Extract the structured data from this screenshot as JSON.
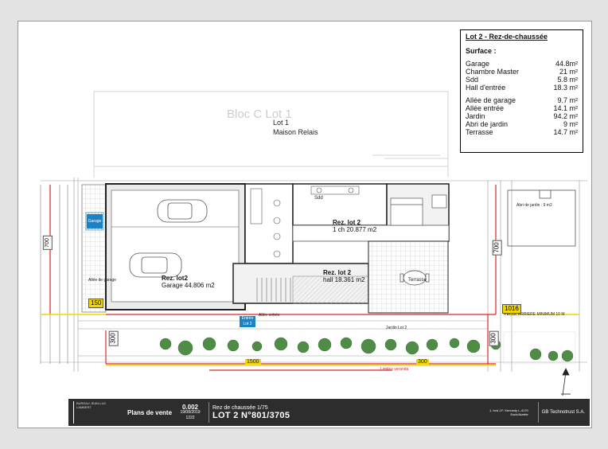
{
  "summary": {
    "title": "Lot 2 - Rez-de-chaussée",
    "surface_label": "Surface :",
    "rows_a": [
      {
        "label": "Garage",
        "value": "44.8m²"
      },
      {
        "label": "Chambre Master",
        "value": "21 m²"
      },
      {
        "label": "Sdd",
        "value": "5.8 m²"
      },
      {
        "label": "Hall d'entrée",
        "value": "18.3 m²"
      }
    ],
    "rows_b": [
      {
        "label": "Allée de garage",
        "value": "9.7 m²"
      },
      {
        "label": "Allée entrée",
        "value": "14.1 m²"
      },
      {
        "label": "Jardin",
        "value": "94.2 m²"
      },
      {
        "label": "Abri de jardin",
        "value": "9 m²"
      },
      {
        "label": "Terrasse",
        "value": "14.7 m²"
      }
    ]
  },
  "plan": {
    "bloc_label": "Bloc C Lot 1",
    "lot1_line1": "Lot 1",
    "lot1_line2": "Maison Relais",
    "garage_title": "Rez. lot2",
    "garage_sub": "Garage 44.806 m2",
    "chambre_title": "Rez. lot 2",
    "chambre_sub": "1 ch 20.877 m2",
    "hall_title": "Rez. lot 2",
    "hall_sub": "hall 18.361 m2",
    "sdd_label": "Sdd",
    "terrasse_label": "Terrasse",
    "allee_garage": "Allée de garage",
    "allee_entree": "Allée entrée",
    "jardin_label": "Jardin Lot 2",
    "abri_label": "Abri de jardin : 9 m2",
    "recul_label": "RECUL ARRIERE MINIMUM 10 M",
    "limite_label": "Limites veranda",
    "entree_label": "Entrée Lot 2",
    "garage_tag": "Garage",
    "dim_700_left": "700",
    "dim_700_right": "700",
    "dim_150": "150",
    "dim_300_left": "300",
    "dim_300_right": "300",
    "dim_1016": "1016",
    "dim_1500": "1500",
    "dim_300_bottom": "300"
  },
  "footer": {
    "logo_text": "BUREAU JEAN-LUC LAMBERT",
    "plans_label": "Plans de vente",
    "ref_num": "0.002",
    "ref_date": "19/08/2019",
    "ref_code": "1222",
    "lot_small": "Rez de chaussée 1/75",
    "lot_big": "LOT 2 N°801/3705",
    "address": "1, bvd J.F. Kennedy L-4170 Esch/Alzette",
    "company": "GB Technotrust S.A."
  },
  "colors": {
    "dim_red": "#d8262e",
    "dim_yellow": "#f2d600",
    "tree_green": "#4f8d47",
    "hatch_blue": "#1b82c4"
  }
}
